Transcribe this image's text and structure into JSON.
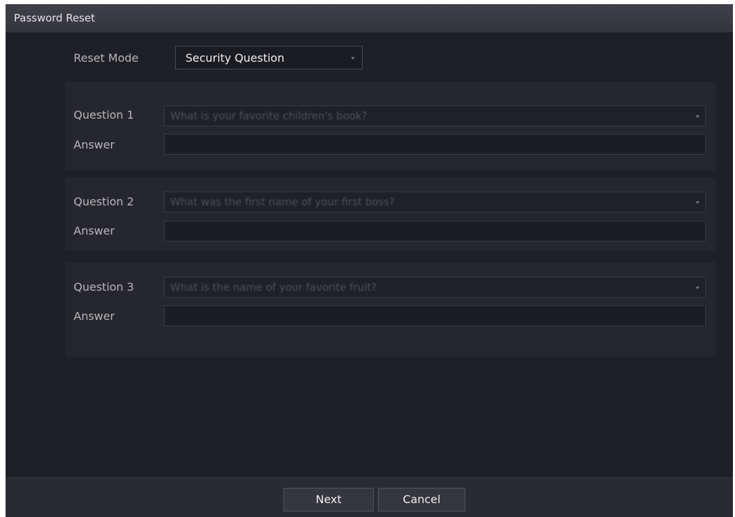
{
  "window": {
    "title": "Password Reset"
  },
  "reset_mode": {
    "label": "Reset Mode",
    "value": "Security Question"
  },
  "questions": [
    {
      "label": "Question 1",
      "question": "What is your favorite children's book?",
      "answer_label": "Answer",
      "answer_value": ""
    },
    {
      "label": "Question 2",
      "question": "What was the first name of your first boss?",
      "answer_label": "Answer",
      "answer_value": ""
    },
    {
      "label": "Question 3",
      "question": "What is the name of your favorite fruit?",
      "answer_label": "Answer",
      "answer_value": ""
    }
  ],
  "footer": {
    "next_label": "Next",
    "cancel_label": "Cancel"
  },
  "colors": {
    "background": "#1f2027",
    "titlebar": "#3a3b43",
    "text": "#e6e6e6"
  }
}
